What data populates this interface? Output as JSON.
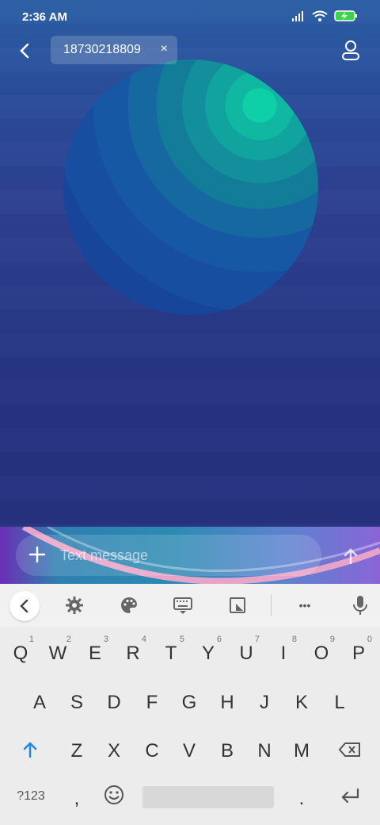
{
  "status": {
    "time": "2:36 AM"
  },
  "header": {
    "recipient": "18730218809",
    "chip_close": "×"
  },
  "composer": {
    "placeholder": "Text message"
  },
  "keyboard": {
    "toolbar": {
      "more": "•••"
    },
    "row1": [
      {
        "k": "Q",
        "n": "1"
      },
      {
        "k": "W",
        "n": "2"
      },
      {
        "k": "E",
        "n": "3"
      },
      {
        "k": "R",
        "n": "4"
      },
      {
        "k": "T",
        "n": "5"
      },
      {
        "k": "Y",
        "n": "6"
      },
      {
        "k": "U",
        "n": "7"
      },
      {
        "k": "I",
        "n": "8"
      },
      {
        "k": "O",
        "n": "9"
      },
      {
        "k": "P",
        "n": "0"
      }
    ],
    "row2": [
      "A",
      "S",
      "D",
      "F",
      "G",
      "H",
      "J",
      "K",
      "L"
    ],
    "row3": [
      "Z",
      "X",
      "C",
      "V",
      "B",
      "N",
      "M"
    ],
    "row4": {
      "sym": "?123",
      "comma": ",",
      "period": "."
    }
  },
  "colors": {
    "accent": "#1e88e5",
    "keyboard_bg": "#ececec",
    "wallpaper_top": "#2b5ea5",
    "wallpaper_bottom": "#27327e"
  }
}
